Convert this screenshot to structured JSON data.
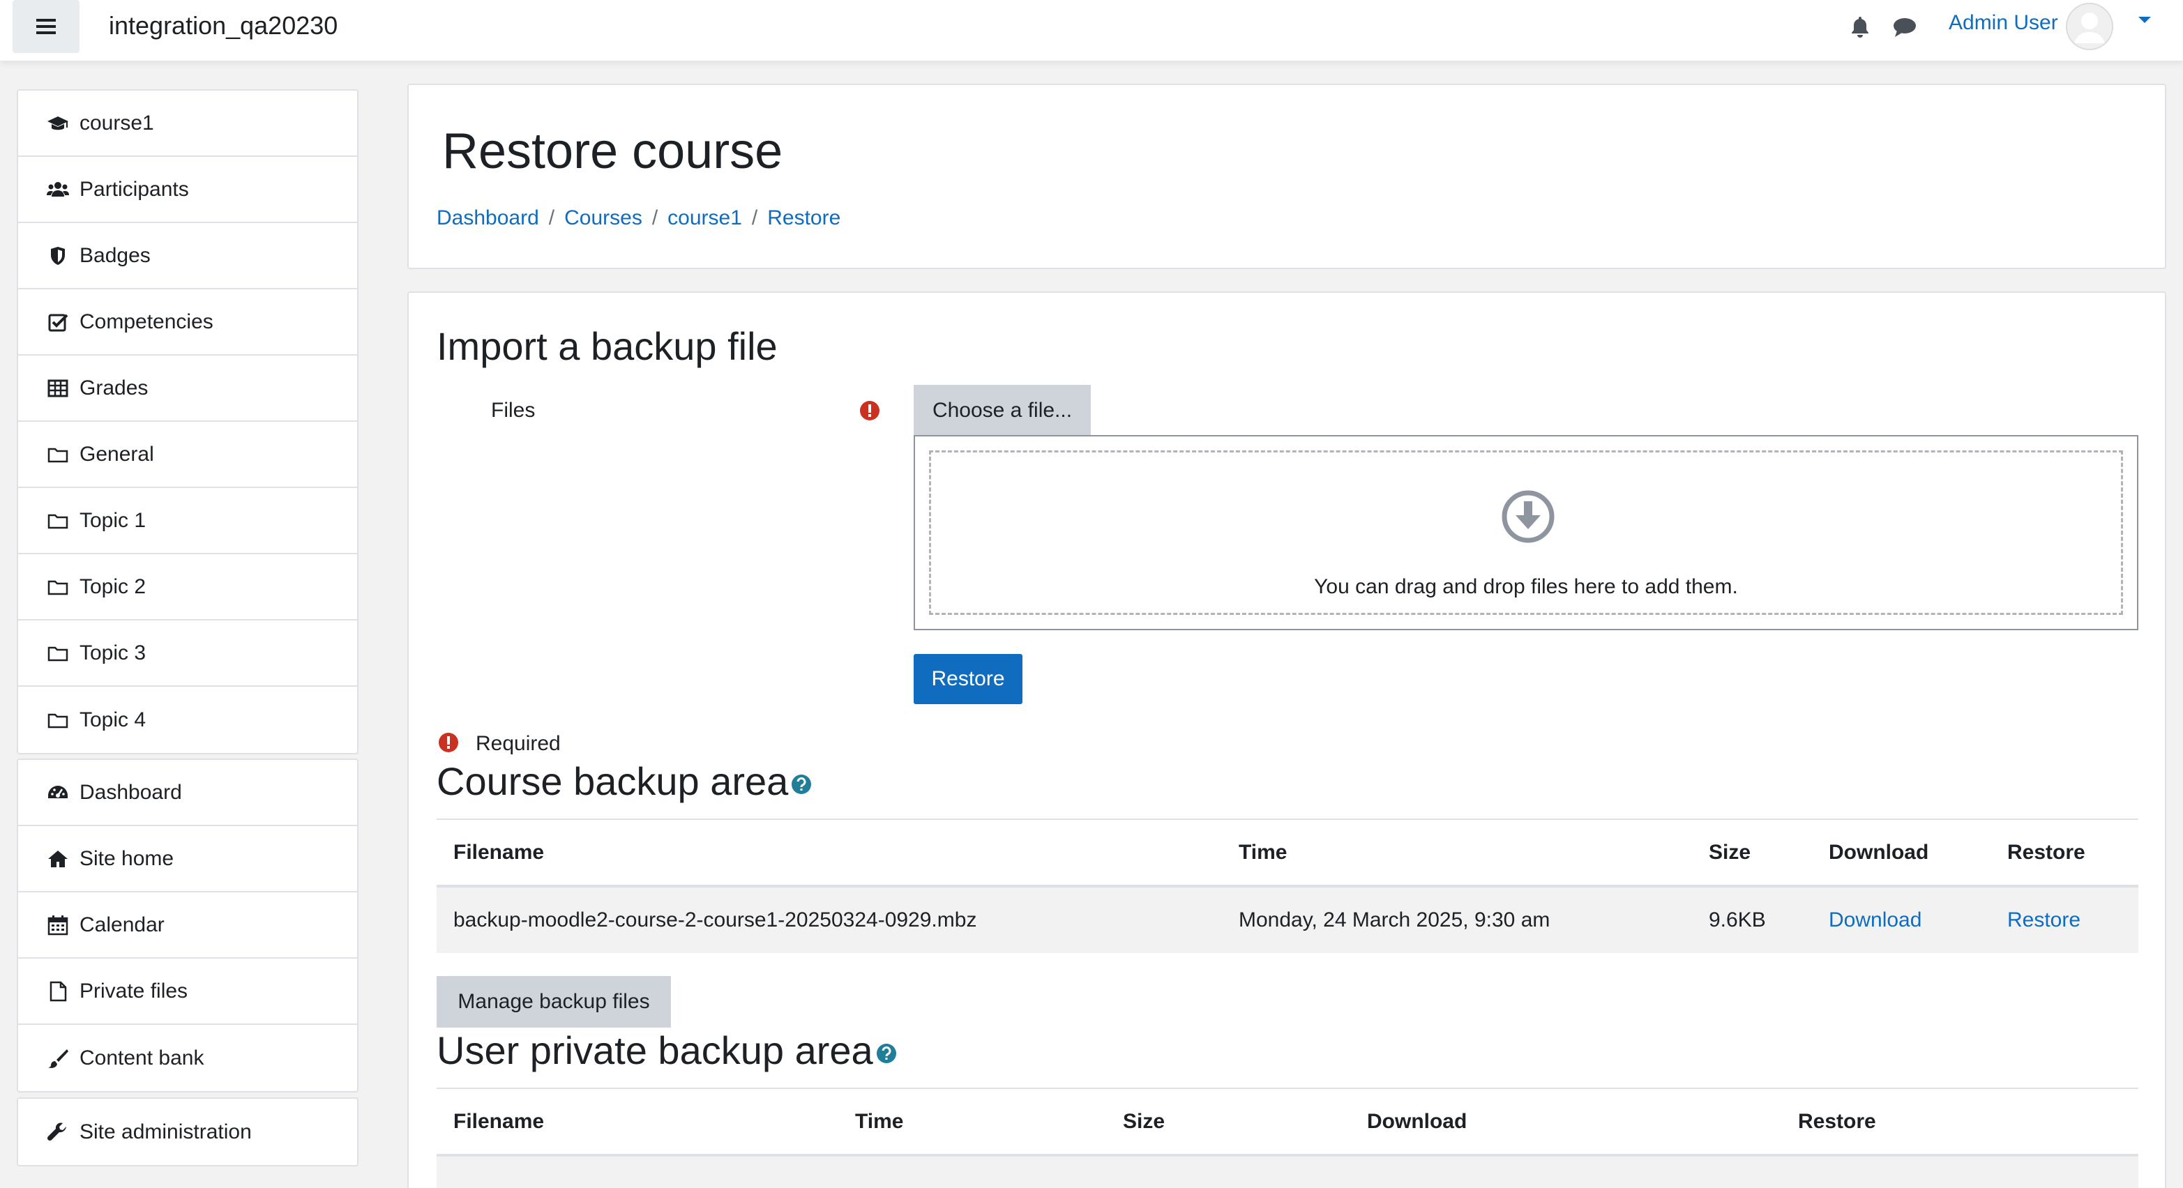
{
  "navbar": {
    "site_name": "integration_qa20230",
    "user_name": "Admin User",
    "icons": [
      "menu-icon",
      "bell-icon",
      "chat-icon",
      "caret-down-icon"
    ]
  },
  "sidebar": {
    "course_items": [
      {
        "label": "course1",
        "icon": "graduation-cap-icon"
      },
      {
        "label": "Participants",
        "icon": "users-icon"
      },
      {
        "label": "Badges",
        "icon": "shield-icon"
      },
      {
        "label": "Competencies",
        "icon": "check-square-icon"
      },
      {
        "label": "Grades",
        "icon": "table-icon"
      },
      {
        "label": "General",
        "icon": "folder-icon"
      },
      {
        "label": "Topic 1",
        "icon": "folder-icon"
      },
      {
        "label": "Topic 2",
        "icon": "folder-icon"
      },
      {
        "label": "Topic 3",
        "icon": "folder-icon"
      },
      {
        "label": "Topic 4",
        "icon": "folder-icon"
      }
    ],
    "site_items": [
      {
        "label": "Dashboard",
        "icon": "dashboard-icon"
      },
      {
        "label": "Site home",
        "icon": "home-icon"
      },
      {
        "label": "Calendar",
        "icon": "calendar-icon"
      },
      {
        "label": "Private files",
        "icon": "file-icon"
      },
      {
        "label": "Content bank",
        "icon": "brush-icon"
      }
    ],
    "admin_items": [
      {
        "label": "Site administration",
        "icon": "wrench-icon"
      }
    ]
  },
  "header": {
    "title": "Restore course",
    "breadcrumb": [
      "Dashboard",
      "Courses",
      "course1",
      "Restore"
    ]
  },
  "import": {
    "heading": "Import a backup file",
    "files_label": "Files",
    "choose_label": "Choose a file...",
    "drop_text": "You can drag and drop files here to add them.",
    "restore_label": "Restore",
    "required_label": "Required"
  },
  "course_backup": {
    "heading": "Course backup area",
    "columns": [
      "Filename",
      "Time",
      "Size",
      "Download",
      "Restore"
    ],
    "rows": [
      {
        "filename": "backup-moodle2-course-2-course1-20250324-0929.mbz",
        "time": "Monday, 24 March 2025, 9:30 am",
        "size": "9.6KB",
        "download": "Download",
        "restore": "Restore"
      }
    ],
    "manage_label": "Manage backup files"
  },
  "user_backup": {
    "heading": "User private backup area",
    "columns": [
      "Filename",
      "Time",
      "Size",
      "Download",
      "Restore"
    ]
  },
  "colors": {
    "link": "#0f6cbf",
    "primary_button": "#0f6cbf",
    "required": "#ca3120",
    "help": "#1f7e9a"
  }
}
